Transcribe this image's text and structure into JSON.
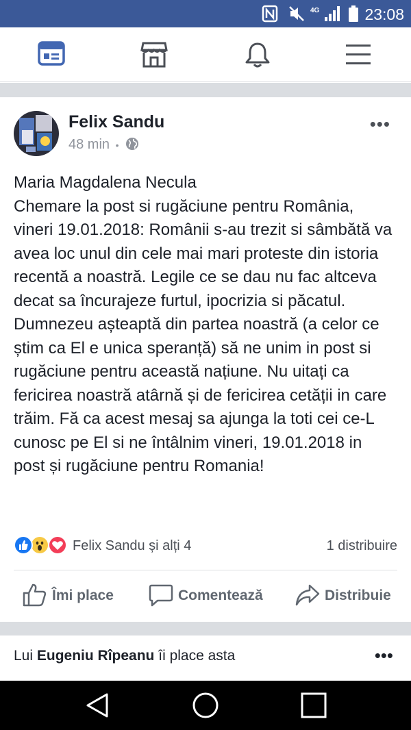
{
  "status_bar": {
    "time": "23:08",
    "network": "4G",
    "bg_color": "#3b5998",
    "icons": [
      "nfc-icon",
      "mute-icon",
      "signal-icon",
      "battery-icon"
    ]
  },
  "topnav": {
    "items": [
      "news-feed-icon",
      "marketplace-icon",
      "notifications-icon",
      "menu-icon"
    ],
    "active_color": "#4267b2",
    "inactive_color": "#4b4f56"
  },
  "post": {
    "author": "Felix Sandu",
    "time": "48 min",
    "separator": "•",
    "privacy_icon": "globe-icon",
    "more": "•••",
    "body": "Maria Magdalena Necula\nChemare la post si rugăciune pentru România, vineri 19.01.2018: Românii s-au trezit si sâmbătă va avea loc unul din cele mai mari proteste din istoria recentă a noastră. Legile ce se dau nu fac altceva decat sa încurajeze furtul, ipocrizia si păcatul. Dumnezeu așteaptă din partea noastră (a celor ce știm ca El e unica speranță) să ne unim in post si rugăciune pentru această națiune. Nu uitați ca fericirea noastră atârnă și de fericirea cetății in care trăim. Fă ca acest mesaj sa ajunga la toti cei ce-L cunosc pe El si ne întâlnim vineri, 19.01.2018 in post și rugăciune pentru Romania!",
    "reactions": {
      "icons": [
        "like-reaction-icon",
        "wow-reaction-icon",
        "love-reaction-icon"
      ],
      "names": "Felix Sandu și alți 4",
      "shares": "1 distribuire"
    },
    "actions": {
      "like": "Îmi place",
      "comment": "Comentează",
      "share": "Distribuie"
    }
  },
  "activity": {
    "prefix": "Lui",
    "name": "Eugeniu Rîpeanu",
    "suffix": "îi place asta",
    "more": "•••"
  },
  "system_nav": [
    "back-icon",
    "home-icon",
    "recents-icon"
  ]
}
